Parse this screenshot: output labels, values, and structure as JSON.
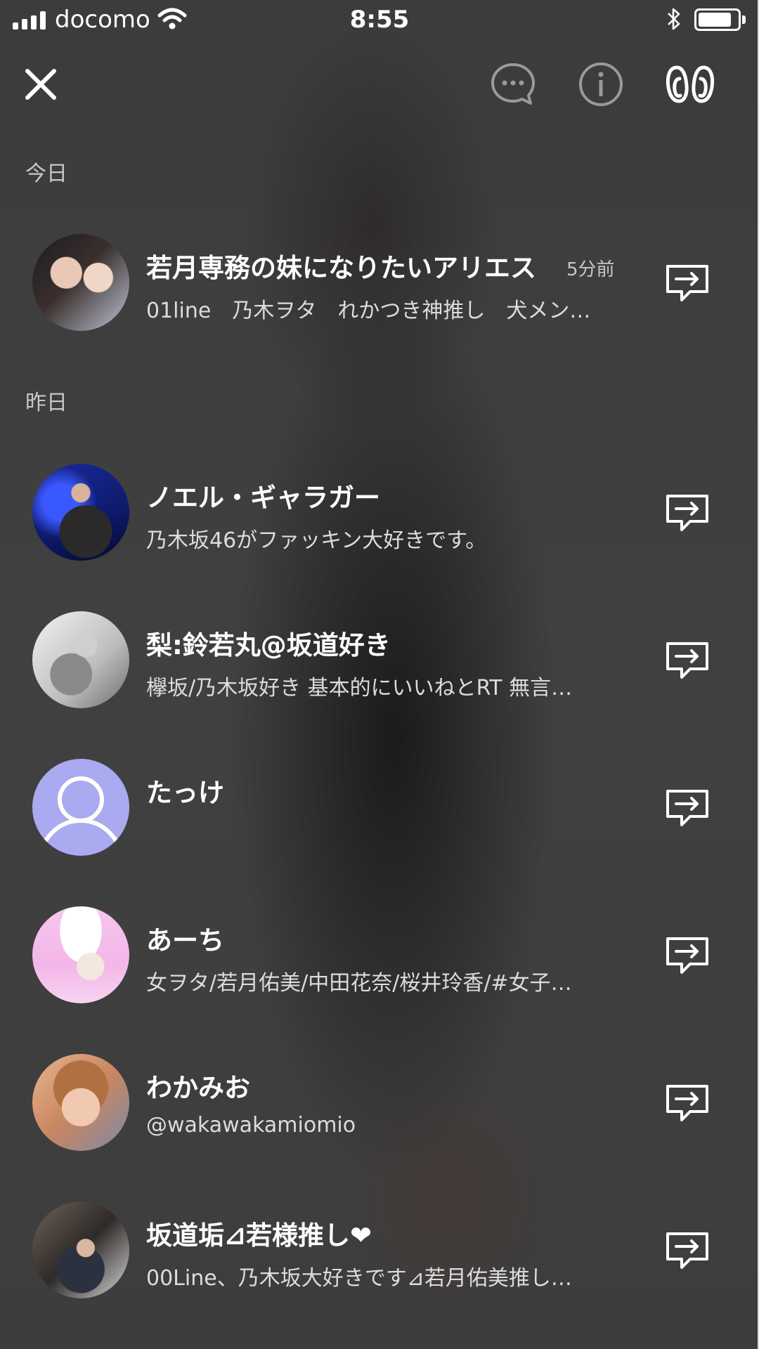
{
  "status_bar": {
    "carrier": "docomo",
    "time": "8:55",
    "battery_level": 0.85
  },
  "toolbar": {
    "close_icon": "close-icon",
    "chat_icon": "chat-bubble-icon",
    "info_icon": "info-icon",
    "footprint_icon": "footprint-icon"
  },
  "sections": {
    "today": "今日",
    "yesterday": "昨日"
  },
  "items": [
    {
      "name": "若月専務の妹になりたいアリエス",
      "time": "5分前",
      "desc": "01line　乃木ヲタ　れかつき神推し　犬メン…",
      "avatar": "photo"
    },
    {
      "name": "ノエル・ギャラガー",
      "desc": "乃木坂46がファッキン大好きです。",
      "avatar": "photo"
    },
    {
      "name": "梨:鈴若丸@坂道好き",
      "desc": "欅坂/乃木坂好き 基本的にいいねとRT 無言…",
      "avatar": "photo"
    },
    {
      "name": "たっけ",
      "desc": "",
      "avatar": "default"
    },
    {
      "name": "あーち",
      "desc": "女ヲタ/若月佑美/中田花奈/桜井玲香/#女子…",
      "avatar": "photo"
    },
    {
      "name": "わかみお",
      "desc": "@wakawakamiomio",
      "avatar": "photo"
    },
    {
      "name": "坂道垢⊿若様推し❤",
      "desc": "00Line、乃木坂大好きです⊿若月佑美推し…",
      "avatar": "photo"
    }
  ],
  "colors": {
    "text": "#ffffff",
    "secondary_text": "#c8c8c8",
    "default_avatar_bg": "#a9aaf0"
  }
}
